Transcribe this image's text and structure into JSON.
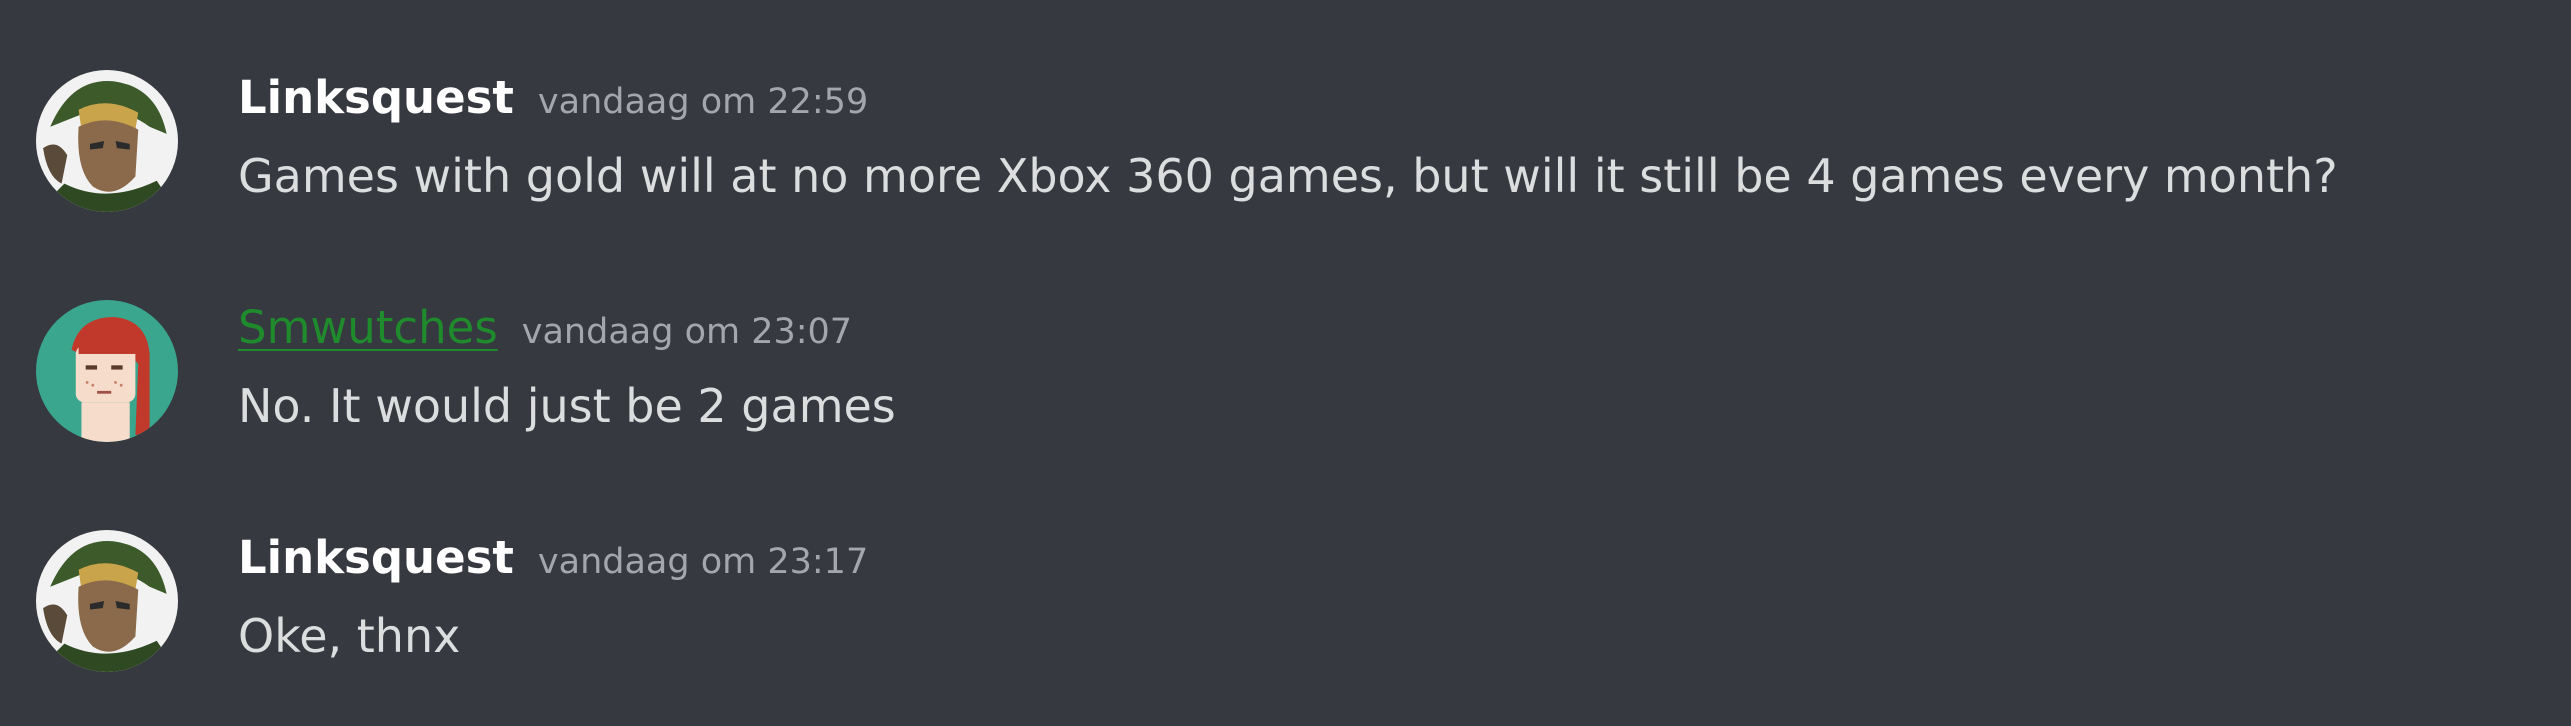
{
  "colors": {
    "background": "#36393f",
    "username_default": "#ffffff",
    "username_green": "#1f8b2c",
    "timestamp": "#a3a6aa",
    "message_text": "#dcddde"
  },
  "messages": [
    {
      "author": "Linksquest",
      "avatar_icon": "link-character-avatar",
      "timestamp": "vandaag om 22:59",
      "text": "Games with gold will at no more Xbox 360 games, but will it still be 4 games every month?"
    },
    {
      "author": "Smwutches",
      "avatar_icon": "red-haired-character-avatar",
      "timestamp": "vandaag om 23:07",
      "text": "No. It would just be 2 games"
    },
    {
      "author": "Linksquest",
      "avatar_icon": "link-character-avatar",
      "timestamp": "vandaag om 23:17",
      "text": "Oke, thnx"
    }
  ]
}
